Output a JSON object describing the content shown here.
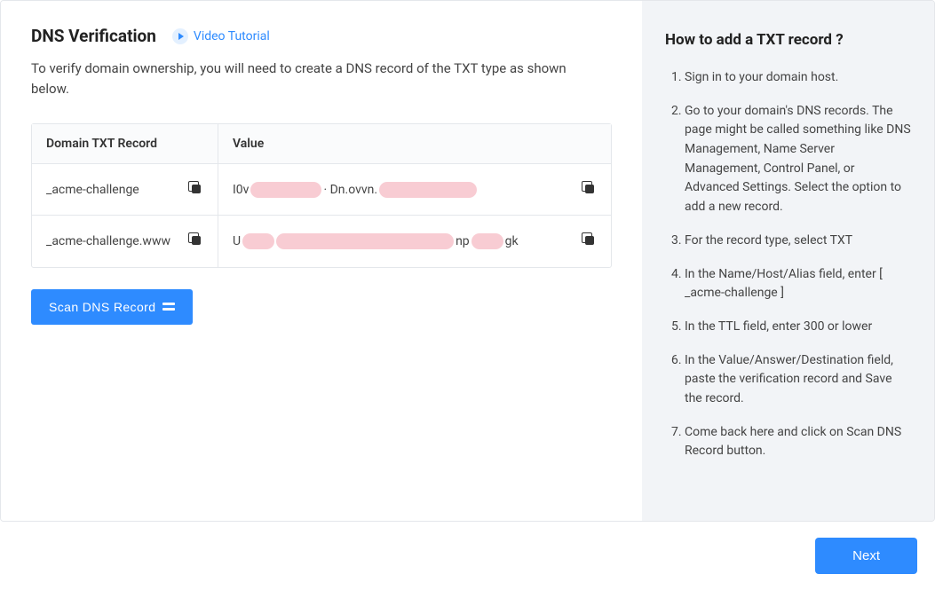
{
  "main": {
    "title": "DNS Verification",
    "tutorial_link": "Video Tutorial",
    "description": "To verify domain ownership, you will need to create a DNS record of the TXT type as shown below.",
    "table": {
      "header_record": "Domain TXT Record",
      "header_value": "Value",
      "rows": [
        {
          "record": "_acme-challenge",
          "value_prefix": "I0v",
          "value_mid": "· Dn.ovvn.",
          "value_suffix": ""
        },
        {
          "record": "_acme-challenge.www",
          "value_prefix": "U",
          "value_mid": "np",
          "value_suffix": "gk"
        }
      ]
    },
    "scan_button": "Scan DNS Record"
  },
  "side": {
    "title": "How to add a TXT record ?",
    "steps": [
      "Sign in to your domain host.",
      "Go to your domain's DNS records. The page might be called something like DNS Management, Name Server Management, Control Panel, or Advanced Settings. Select the option to add a new record.",
      "For the record type, select TXT",
      "In the Name/Host/Alias field, enter [ _acme-challenge ]",
      "In the TTL field, enter 300 or lower",
      "In the Value/Answer/Destination field, paste the verification record and Save the record.",
      "Come back here and click on Scan DNS Record button."
    ]
  },
  "footer": {
    "next": "Next"
  }
}
